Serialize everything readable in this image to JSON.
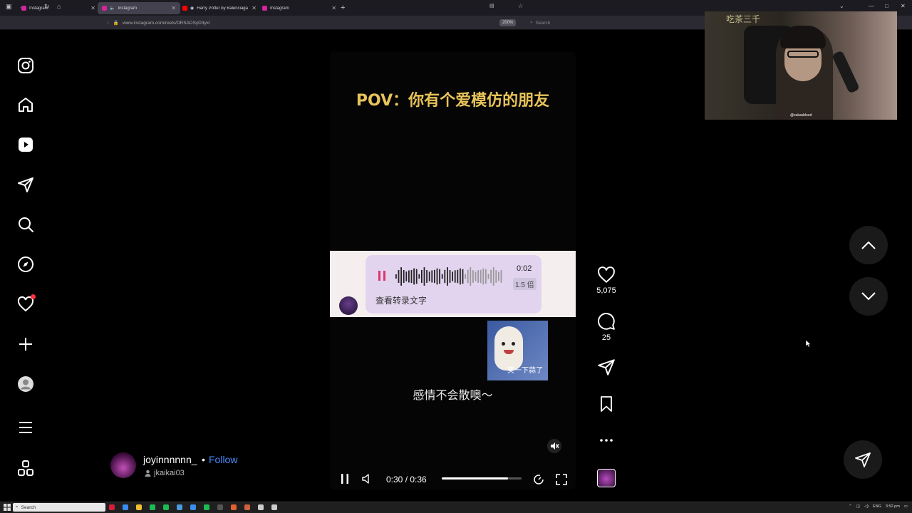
{
  "browser": {
    "tabs": [
      {
        "title": "Instagram",
        "favicon_color": "#d6249f",
        "active": false
      },
      {
        "title": "Instagram",
        "favicon_color": "#d6249f",
        "active": true,
        "audio": true
      },
      {
        "title": "Harry Potter by Balenciaga",
        "favicon_color": "#ff0000",
        "active": false,
        "audio": true
      },
      {
        "title": "Instagram",
        "favicon_color": "#d6249f",
        "active": false
      }
    ],
    "url": "www.instagram.com/reels/DRSADSyD3yk/",
    "zoom": "200%",
    "search_placeholder": "Search"
  },
  "sidebar": {
    "items": [
      "instagram-logo",
      "home",
      "reels",
      "messages",
      "search",
      "explore",
      "notifications",
      "create",
      "profile",
      "more",
      "also-from-meta"
    ]
  },
  "reel": {
    "title": "POV：你有个爱模仿的朋友",
    "voice": {
      "duration": "0:02",
      "speed": "1.5 倍",
      "transcribe": "查看转录文字"
    },
    "sticker_text": "笑一下蒜了",
    "subtitle": "感情不会散噢～",
    "time": "0:30 / 0:36",
    "progress": 0.83
  },
  "actions": {
    "likes": "5,075",
    "comments": "25"
  },
  "author": {
    "username": "joyinnnnnn_",
    "separator": "•",
    "follow": "Follow",
    "audio_user": "jkaikai03"
  },
  "webcam": {
    "logo": "吃茶三千",
    "handle": "@sukasblood"
  },
  "taskbar": {
    "search": "Search",
    "lang": "ENG",
    "time": "3:52 pm",
    "icon_colors": [
      "#d71d3b",
      "#3b8cf0",
      "#f0c030",
      "#1db954",
      "#1db954",
      "#4a9be0",
      "#3b8cf0",
      "#1db954",
      "#555",
      "#e06030",
      "#d06040",
      "#ccc",
      "#ccc"
    ]
  }
}
